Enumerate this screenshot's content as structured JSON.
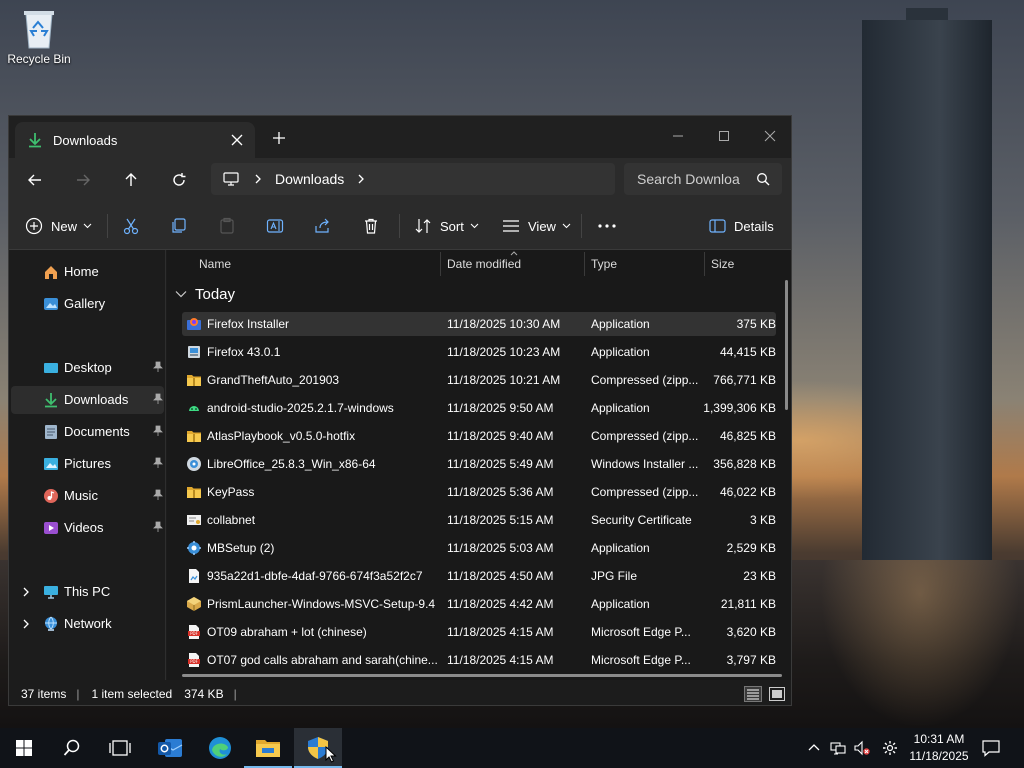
{
  "desktop": {
    "icons": [
      {
        "label": "Recycle Bin",
        "icon": "recycle-bin-icon"
      }
    ]
  },
  "window": {
    "tab_title": "Downloads",
    "address": {
      "crumbs": [
        "Downloads"
      ]
    },
    "search": {
      "placeholder": "Search Downloa"
    },
    "toolbar": {
      "new_label": "New",
      "sort_label": "Sort",
      "view_label": "View",
      "details_label": "Details"
    },
    "sidebar": {
      "items": [
        {
          "label": "Home",
          "icon": "home-icon"
        },
        {
          "label": "Gallery",
          "icon": "gallery-icon"
        },
        {
          "label": "Desktop",
          "icon": "desktop-icon",
          "pinned": true
        },
        {
          "label": "Downloads",
          "icon": "download-icon",
          "pinned": true,
          "active": true
        },
        {
          "label": "Documents",
          "icon": "documents-icon",
          "pinned": true
        },
        {
          "label": "Pictures",
          "icon": "pictures-icon",
          "pinned": true
        },
        {
          "label": "Music",
          "icon": "music-icon",
          "pinned": true
        },
        {
          "label": "Videos",
          "icon": "videos-icon",
          "pinned": true
        },
        {
          "label": "This PC",
          "icon": "computer-icon",
          "expandable": true
        },
        {
          "label": "Network",
          "icon": "network-icon",
          "expandable": true
        }
      ]
    },
    "columns": {
      "name": "Name",
      "date": "Date modified",
      "type": "Type",
      "size": "Size"
    },
    "group_label": "Today",
    "files": [
      {
        "name": "Firefox Installer",
        "date": "11/18/2025 10:30 AM",
        "type": "Application",
        "size": "375 KB",
        "icon": "firefox-icon",
        "selected": true
      },
      {
        "name": "Firefox 43.0.1",
        "date": "11/18/2025 10:23 AM",
        "type": "Application",
        "size": "44,415 KB",
        "icon": "installer-icon"
      },
      {
        "name": "GrandTheftAuto_201903",
        "date": "11/18/2025 10:21 AM",
        "type": "Compressed (zipp...",
        "size": "766,771 KB",
        "icon": "zip-folder-icon"
      },
      {
        "name": "android-studio-2025.2.1.7-windows",
        "date": "11/18/2025 9:50 AM",
        "type": "Application",
        "size": "1,399,306 KB",
        "icon": "android-icon"
      },
      {
        "name": "AtlasPlaybook_v0.5.0-hotfix",
        "date": "11/18/2025 9:40 AM",
        "type": "Compressed (zipp...",
        "size": "46,825 KB",
        "icon": "zip-folder-icon"
      },
      {
        "name": "LibreOffice_25.8.3_Win_x86-64",
        "date": "11/18/2025 5:49 AM",
        "type": "Windows Installer ...",
        "size": "356,828 KB",
        "icon": "msi-icon"
      },
      {
        "name": "KeyPass",
        "date": "11/18/2025 5:36 AM",
        "type": "Compressed (zipp...",
        "size": "46,022 KB",
        "icon": "zip-folder-icon"
      },
      {
        "name": "collabnet",
        "date": "11/18/2025 5:15 AM",
        "type": "Security Certificate",
        "size": "3 KB",
        "icon": "certificate-icon"
      },
      {
        "name": "MBSetup (2)",
        "date": "11/18/2025 5:03 AM",
        "type": "Application",
        "size": "2,529 KB",
        "icon": "setup-gear-icon"
      },
      {
        "name": "935a22d1-dbfe-4daf-9766-674f3a52f2c7",
        "date": "11/18/2025 4:50 AM",
        "type": "JPG File",
        "size": "23 KB",
        "icon": "image-file-icon"
      },
      {
        "name": "PrismLauncher-Windows-MSVC-Setup-9.4",
        "date": "11/18/2025 4:42 AM",
        "type": "Application",
        "size": "21,811 KB",
        "icon": "prism-icon"
      },
      {
        "name": "OT09 abraham + lot (chinese)",
        "date": "11/18/2025 4:15 AM",
        "type": "Microsoft Edge P...",
        "size": "3,620 KB",
        "icon": "pdf-icon"
      },
      {
        "name": "OT07 god calls abraham and sarah(chine...",
        "date": "11/18/2025 4:15 AM",
        "type": "Microsoft Edge P...",
        "size": "3,797 KB",
        "icon": "pdf-icon"
      }
    ],
    "status": {
      "count": "37 items",
      "selection": "1 item selected",
      "size": "374 KB",
      "sep": "|"
    }
  },
  "taskbar": {
    "apps": [
      {
        "name": "start",
        "icon": "windows-logo-icon"
      },
      {
        "name": "search",
        "icon": "search-icon"
      },
      {
        "name": "task-view",
        "icon": "task-view-icon"
      },
      {
        "name": "outlook",
        "icon": "outlook-icon"
      },
      {
        "name": "edge",
        "icon": "edge-icon"
      },
      {
        "name": "file-explorer",
        "icon": "folder-icon",
        "running": true
      },
      {
        "name": "security",
        "icon": "shield-icon",
        "running": true,
        "active": true
      }
    ],
    "time": "10:31 AM",
    "date": "11/18/2025"
  },
  "colors": {
    "accent": "#76b9ed",
    "window_bg": "#1c1c1c",
    "toolbar_bg": "#2b2b2b",
    "folder": "#f2c14e"
  }
}
